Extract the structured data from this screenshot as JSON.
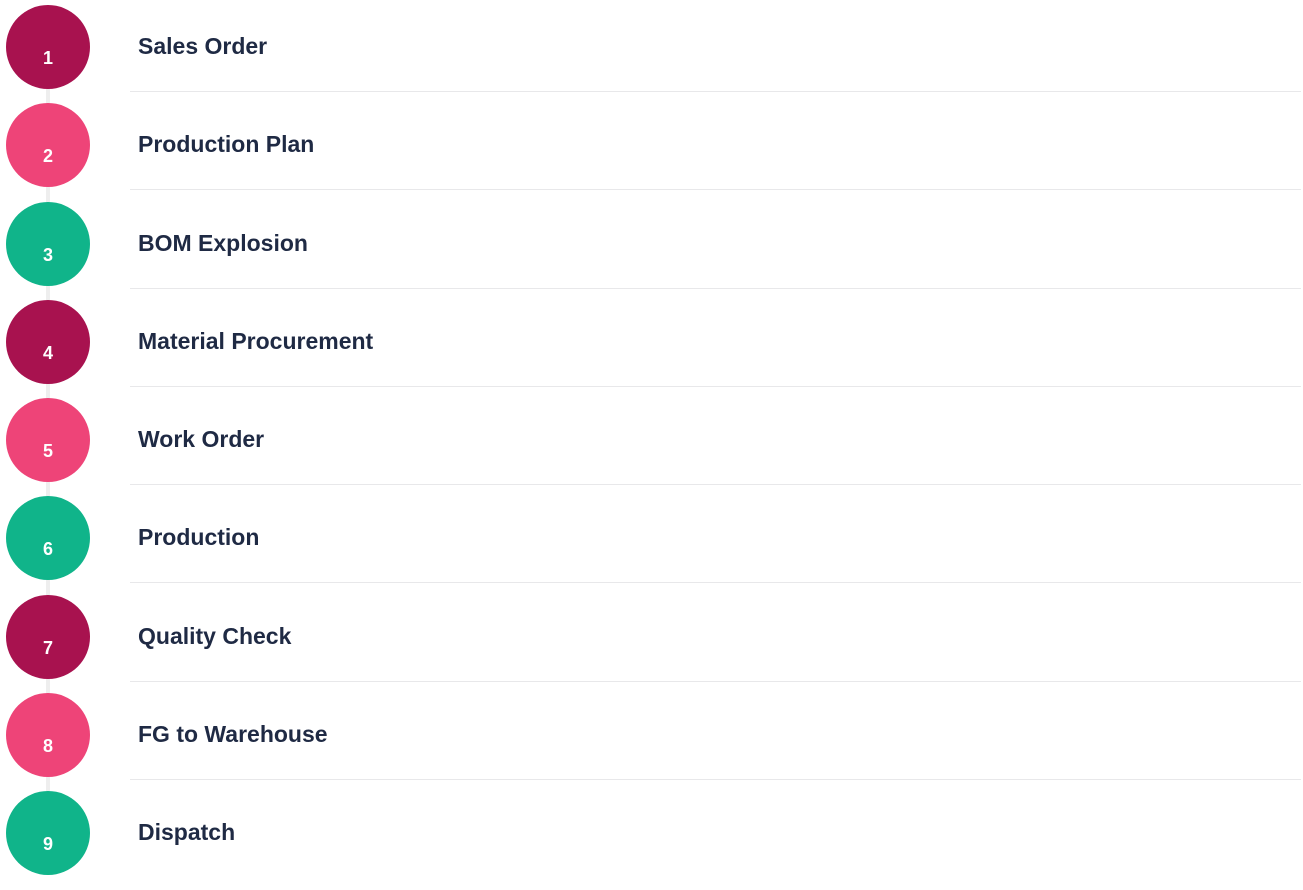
{
  "colors": {
    "crimson": "#a8124f",
    "pink": "#ee4478",
    "teal": "#10b48a",
    "label_text": "#1f2a44"
  },
  "steps": [
    {
      "number": "1",
      "label": "Sales Order",
      "color": "#a8124f"
    },
    {
      "number": "2",
      "label": "Production Plan",
      "color": "#ee4478"
    },
    {
      "number": "3",
      "label": "BOM Explosion",
      "color": "#10b48a"
    },
    {
      "number": "4",
      "label": "Material Procurement",
      "color": "#a8124f"
    },
    {
      "number": "5",
      "label": "Work Order",
      "color": "#ee4478"
    },
    {
      "number": "6",
      "label": "Production",
      "color": "#10b48a"
    },
    {
      "number": "7",
      "label": "Quality Check",
      "color": "#a8124f"
    },
    {
      "number": "8",
      "label": "FG to Warehouse",
      "color": "#ee4478"
    },
    {
      "number": "9",
      "label": "Dispatch",
      "color": "#10b48a"
    }
  ]
}
